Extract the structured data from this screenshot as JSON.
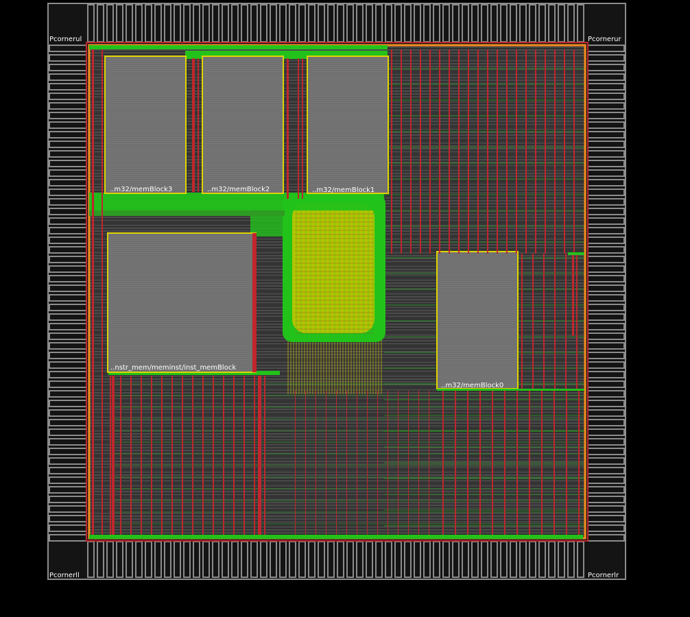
{
  "viewer": {
    "background": "#000000",
    "colors": {
      "pad_ring": "#8c8c8c",
      "core_fill": "#4a4a4a",
      "macro_fill": "#7a7a7a",
      "metal_red": "#c0262c",
      "metal_green": "#22c21a",
      "metal_yellow": "#e0d400",
      "core_border_orange": "#f28c1a",
      "label": "#ffffff"
    }
  },
  "corners": {
    "upper_left": "Pcornerul",
    "upper_right": "Pcornerur",
    "lower_left": "Pcornerll",
    "lower_right": "Pcornerlr"
  },
  "macros": {
    "mem_block_3": "..m32/memBlock3",
    "mem_block_2": "..m32/memBlock2",
    "mem_block_1": "..m32/memBlock1",
    "mem_block_0": "..m32/memBlock0",
    "instr_mem": "..nstr_mem/meminst/inst_memBlock"
  }
}
